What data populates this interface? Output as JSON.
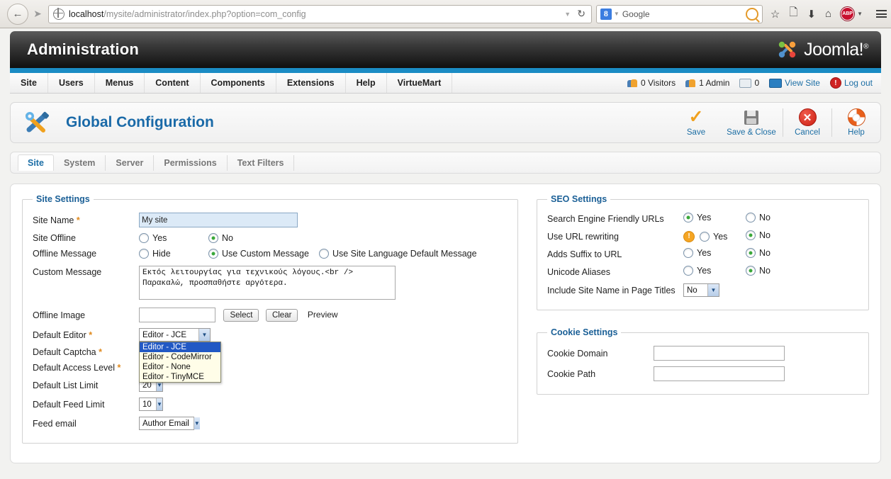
{
  "browser": {
    "url_host": "localhost",
    "url_path": "/mysite/administrator/index.php?option=com_config",
    "search_engine": "Google",
    "search_badge": "8",
    "back_icon": "back-arrow-icon",
    "forward_icon": "forward-arrow-icon",
    "reload_icon": "reload-icon",
    "bookmark_icon": "star-icon",
    "library_icon": "library-icon",
    "downloads_icon": "download-icon",
    "home_icon": "home-icon",
    "adblock_icon": "ABP",
    "menu_icon": "hamburger-menu-icon"
  },
  "header": {
    "title": "Administration",
    "logo_text": "Joomla!",
    "logo_sup": "®",
    "accent_blue": "#1b8cc4"
  },
  "menubar": {
    "items": [
      {
        "label": "Site"
      },
      {
        "label": "Users"
      },
      {
        "label": "Menus"
      },
      {
        "label": "Content"
      },
      {
        "label": "Components"
      },
      {
        "label": "Extensions"
      },
      {
        "label": "Help"
      },
      {
        "label": "VirtueMart"
      }
    ],
    "status": {
      "visitors": "0 Visitors",
      "admins": "1 Admin",
      "messages": "0",
      "view_site": "View Site",
      "logout": "Log out"
    }
  },
  "page": {
    "title": "Global Configuration",
    "title_color": "#1a6aa8",
    "icon": "wrench-screwdriver-icon"
  },
  "toolbar": {
    "save_label": "Save",
    "save_close_label": "Save & Close",
    "cancel_label": "Cancel",
    "help_label": "Help"
  },
  "tabs": [
    {
      "label": "Site",
      "active": true
    },
    {
      "label": "System",
      "active": false
    },
    {
      "label": "Server",
      "active": false
    },
    {
      "label": "Permissions",
      "active": false
    },
    {
      "label": "Text Filters",
      "active": false
    }
  ],
  "site_settings": {
    "legend": "Site Settings",
    "site_name_label": "Site Name",
    "site_name_value": "My site",
    "site_offline_label": "Site Offline",
    "site_offline_yes": "Yes",
    "site_offline_no": "No",
    "site_offline_selected": "No",
    "offline_message_label": "Offline Message",
    "offline_hide": "Hide",
    "offline_custom": "Use Custom Message",
    "offline_default": "Use Site Language Default Message",
    "offline_message_selected": "Use Custom Message",
    "custom_message_label": "Custom Message",
    "custom_message_value": "Εκτός λειτουργίας για τεχνικούς λόγους.<br />\nΠαρακαλώ, προσπαθήστε αργότερα.",
    "offline_image_label": "Offline Image",
    "offline_image_value": "",
    "select_button": "Select",
    "clear_button": "Clear",
    "preview_label": "Preview",
    "default_editor_label": "Default Editor",
    "default_editor_value": "Editor - JCE",
    "default_editor_options": [
      "Editor - JCE",
      "Editor - CodeMirror",
      "Editor - None",
      "Editor - TinyMCE"
    ],
    "default_editor_open": true,
    "default_captcha_label": "Default Captcha",
    "default_access_label": "Default Access Level",
    "default_list_limit_label": "Default List Limit",
    "default_list_limit_value": "20",
    "default_feed_limit_label": "Default Feed Limit",
    "default_feed_limit_value": "10",
    "feed_email_label": "Feed email",
    "feed_email_value": "Author Email"
  },
  "seo_settings": {
    "legend": "SEO Settings",
    "rows": [
      {
        "label": "Search Engine Friendly URLs",
        "yes": "Yes",
        "no": "No",
        "selected": "Yes",
        "warn": false
      },
      {
        "label": "Use URL rewriting",
        "yes": "Yes",
        "no": "No",
        "selected": "No",
        "warn": true
      },
      {
        "label": "Adds Suffix to URL",
        "yes": "Yes",
        "no": "No",
        "selected": "No",
        "warn": false
      },
      {
        "label": "Unicode Aliases",
        "yes": "Yes",
        "no": "No",
        "selected": "No",
        "warn": false
      }
    ],
    "include_site_name_label": "Include Site Name in Page Titles",
    "include_site_name_value": "No"
  },
  "cookie_settings": {
    "legend": "Cookie Settings",
    "cookie_domain_label": "Cookie Domain",
    "cookie_domain_value": "",
    "cookie_path_label": "Cookie Path",
    "cookie_path_value": ""
  }
}
